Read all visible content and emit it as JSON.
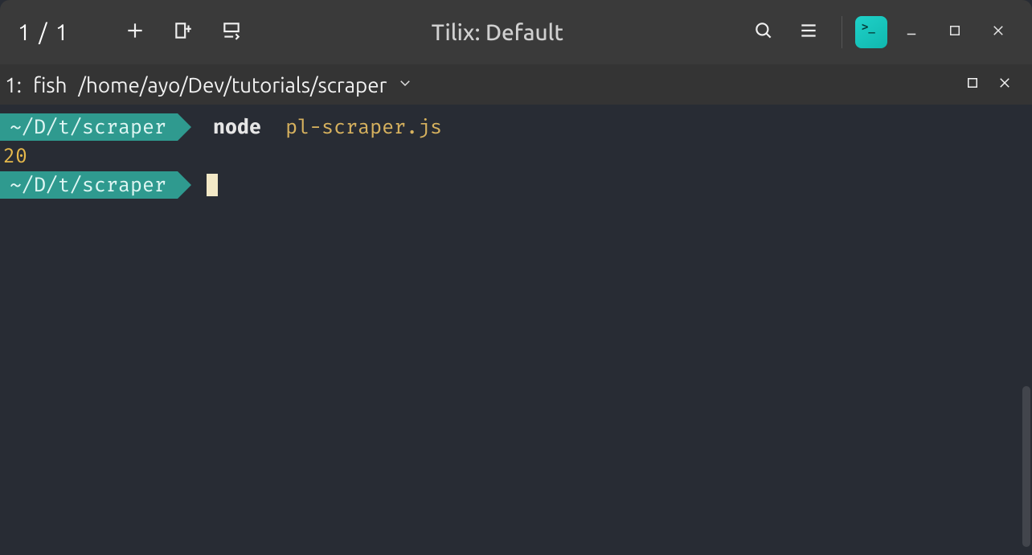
{
  "titlebar": {
    "session_counter": "1 / 1",
    "title": "Tilix: Default"
  },
  "tab": {
    "index": "1:",
    "shell": "fish",
    "cwd": "/home/ayo/Dev/tutorials/scraper"
  },
  "terminal": {
    "prompt_path": "~/D/t/scraper",
    "lines": [
      {
        "cmd_bin": "node",
        "cmd_arg": "pl-scraper.js"
      },
      {
        "output": "20"
      }
    ]
  },
  "colors": {
    "bg": "#282c34",
    "prompt_bg": "#2f9a8f",
    "accent_gold": "#d6b15e",
    "output_yellow": "#e5b84b"
  },
  "icons": {
    "chevron_down": "chevron-down-icon",
    "plus": "plus-icon",
    "split_right": "split-right-icon",
    "split_down": "split-down-icon",
    "search": "search-icon",
    "hamburger": "hamburger-icon",
    "minimize": "minimize-icon",
    "maximize": "maximize-icon",
    "close": "close-icon"
  }
}
